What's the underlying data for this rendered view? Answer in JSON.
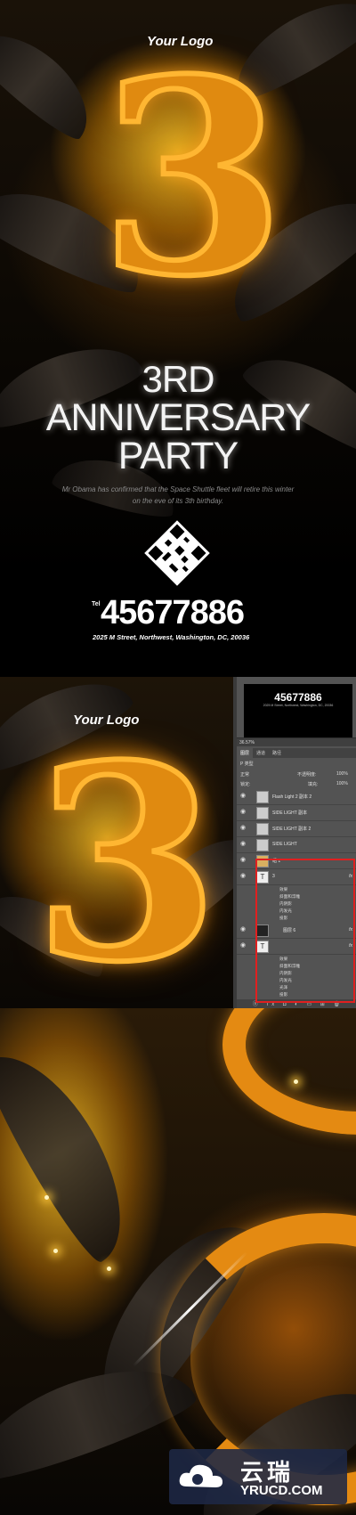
{
  "poster": {
    "logo": "Your Logo",
    "numeral": "3",
    "title_lines": [
      "3RD",
      "ANNIVERSARY",
      "PARTY"
    ],
    "description_lines": [
      "Mr Obama has confirmed that the Space Shuttle fleet will retire this winter",
      "on the eve of its 3th birthday."
    ],
    "tel_label": "Tel",
    "tel": "45677886",
    "address": "2025 M Street, Northwest, Washington, DC, 20036"
  },
  "psview": {
    "logo": "Your Logo",
    "numeral": "3",
    "thumb_tel": "45677886",
    "thumb_address": "2025 M Street, Northwest, Washington, DC, 20036",
    "zoom": "36.57%",
    "tabs": [
      "图层",
      "通道",
      "路径"
    ],
    "filter_label": "P 类型",
    "blend_mode": "正常",
    "opacity_label": "不透明度:",
    "opacity": "100%",
    "lock_label": "锁定:",
    "fill_label": "填充:",
    "fill": "100%",
    "layers": [
      {
        "name": "Flash Light 2 副本 2",
        "fx": ""
      },
      {
        "name": "SIDE LIGHT 副本",
        "fx": ""
      },
      {
        "name": "SIDE LIGHT 副本 2",
        "fx": ""
      },
      {
        "name": "SIDE LIGHT",
        "fx": ""
      },
      {
        "name": "组 1",
        "fx": ""
      },
      {
        "name": "3",
        "fx": "fx"
      }
    ],
    "effects_a": [
      "效果",
      "斜面和浮雕",
      "内阴影",
      "内发光",
      "投影"
    ],
    "layers_b": [
      {
        "name": "图层 6",
        "fx": "fx"
      },
      {
        "name": "",
        "fx": "fx"
      }
    ],
    "effects_b": [
      "效果",
      "斜面和浮雕",
      "内阴影",
      "内发光",
      "光泽",
      "投影"
    ],
    "bottom_icons": "ⓞ fx ◘ ◐ ▭ ⊞ 🗑"
  },
  "watermark": {
    "cn": "云瑞",
    "en": "YRUCD.COM"
  },
  "colors": {
    "accent_orange": "#e08a10",
    "gold_glow": "#ffc828",
    "highlight_red": "#e02020",
    "watermark_bg": "#1e2846"
  }
}
